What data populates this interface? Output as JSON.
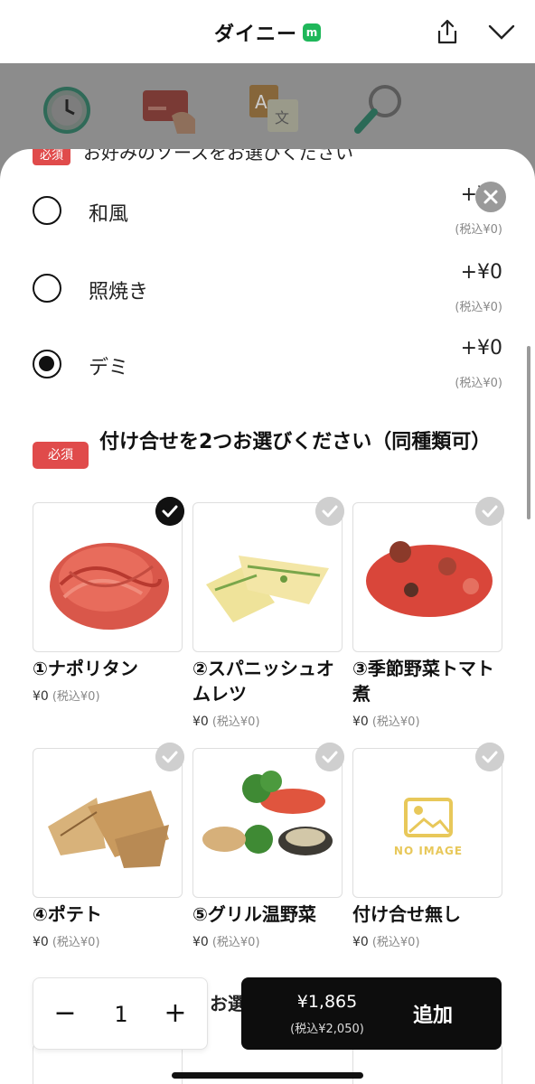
{
  "header": {
    "title": "ダイニー",
    "badge": "m"
  },
  "sheet": {
    "peek_text": "お好みのソースをお選びください",
    "peek_badge": "必須",
    "sauce_options": [
      {
        "label": "和風",
        "price": "+¥0",
        "tax": "(税込¥0)",
        "selected": false
      },
      {
        "label": "照焼き",
        "price": "+¥0",
        "tax": "(税込¥0)",
        "selected": false
      },
      {
        "label": "デミ",
        "price": "+¥0",
        "tax": "(税込¥0)",
        "selected": true
      }
    ],
    "side_section": {
      "badge": "必須",
      "title": "付け合せを2つお選びください（同種類可）"
    },
    "side_items": [
      {
        "name": "①ナポリタン",
        "price": "¥0",
        "tax": "(税込¥0)",
        "selected": true
      },
      {
        "name": "②スパニッシュオムレツ",
        "price": "¥0",
        "tax": "(税込¥0)",
        "selected": false
      },
      {
        "name": "③季節野菜トマト煮",
        "price": "¥0",
        "tax": "(税込¥0)",
        "selected": false
      },
      {
        "name": "④ポテト",
        "price": "¥0",
        "tax": "(税込¥0)",
        "selected": false
      },
      {
        "name": "⑤グリル温野菜",
        "price": "¥0",
        "tax": "(税込¥0)",
        "selected": false
      },
      {
        "name": "付け合せ無し",
        "price": "¥0",
        "tax": "(税込¥0)",
        "selected": false,
        "placeholder": "NO IMAGE"
      }
    ],
    "next_section_peek": "お選"
  },
  "footer": {
    "quantity": "1",
    "minus": "−",
    "plus": "+",
    "total": "¥1,865",
    "total_tax": "(税込¥2,050)",
    "add_label": "追加"
  },
  "colors": {
    "required_badge": "#e04b4b",
    "primary": "#0d0d0d",
    "badge_green": "#1fb75a"
  }
}
